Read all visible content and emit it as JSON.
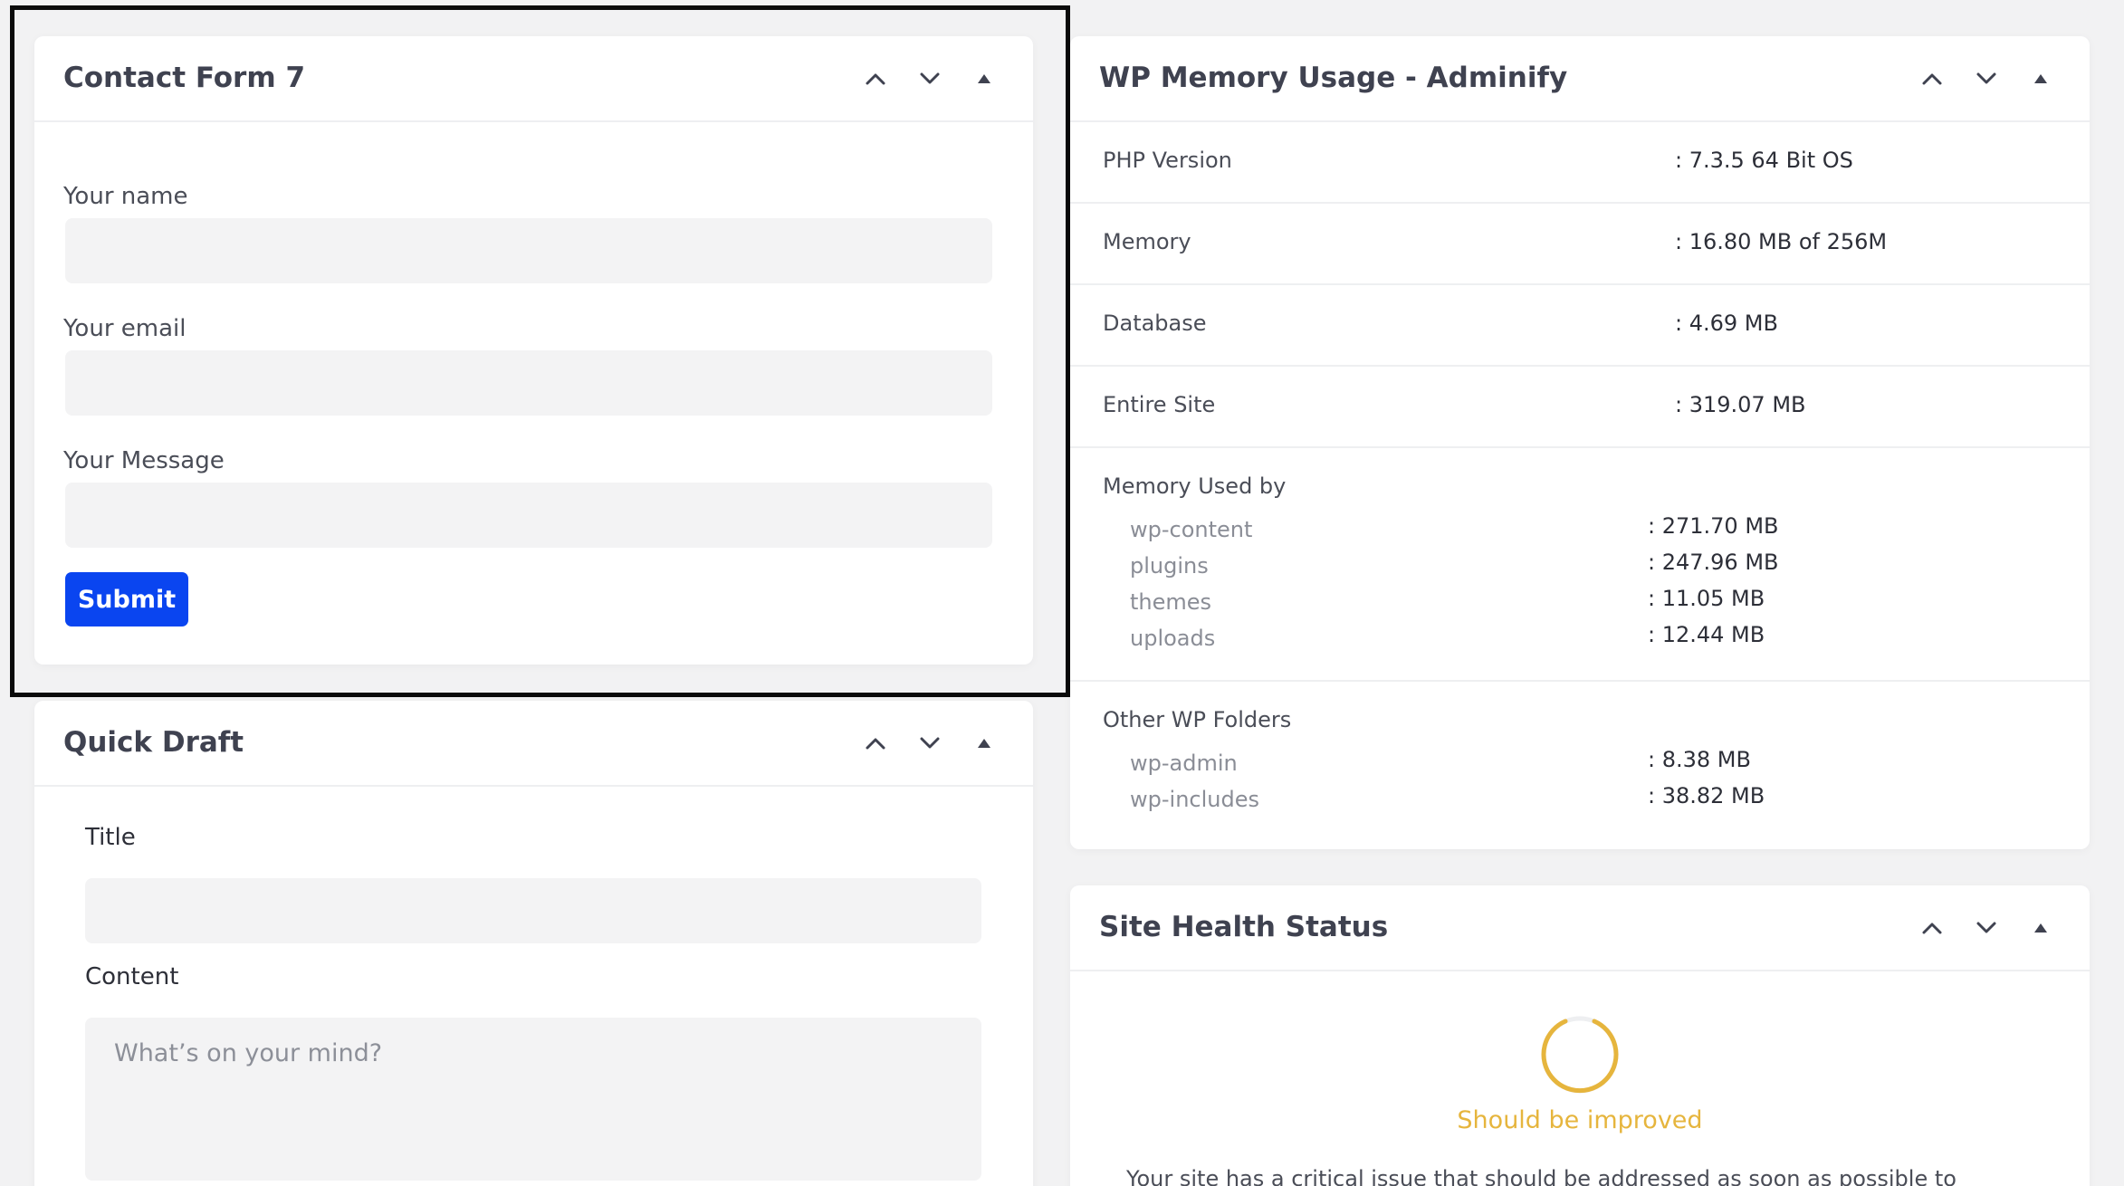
{
  "contact_form": {
    "title": "Contact Form 7",
    "name_label": "Your name",
    "name_value": "",
    "email_label": "Your email",
    "email_value": "",
    "message_label": "Your Message",
    "message_value": "",
    "submit_label": "Submit"
  },
  "quick_draft": {
    "title": "Quick Draft",
    "title_label": "Title",
    "title_value": "",
    "content_label": "Content",
    "content_placeholder": "What’s on your mind?"
  },
  "memory_usage": {
    "title": "WP Memory Usage - Adminify",
    "rows": [
      {
        "label": "PHP Version",
        "value": ": 7.3.5 64 Bit OS"
      },
      {
        "label": "Memory",
        "value": ": 16.80 MB of 256M"
      },
      {
        "label": "Database",
        "value": ": 4.69 MB"
      },
      {
        "label": "Entire Site",
        "value": ": 319.07 MB"
      }
    ],
    "used_by": {
      "label": "Memory Used by",
      "items": [
        {
          "label": "wp-content",
          "value": ": 271.70 MB"
        },
        {
          "label": "plugins",
          "value": ": 247.96 MB"
        },
        {
          "label": "themes",
          "value": ": 11.05 MB"
        },
        {
          "label": "uploads",
          "value": ": 12.44 MB"
        }
      ]
    },
    "other_folders": {
      "label": "Other WP Folders",
      "items": [
        {
          "label": "wp-admin",
          "value": ": 8.38 MB"
        },
        {
          "label": "wp-includes",
          "value": ": 38.82 MB"
        }
      ]
    }
  },
  "site_health": {
    "title": "Site Health Status",
    "status": "Should be improved",
    "description": "Your site has a critical issue that should be addressed as soon as possible to"
  },
  "colors": {
    "accent_blue": "#0a45f0",
    "health_warning": "#e6b53d",
    "card_bg": "#ffffff",
    "page_bg": "#f2f2f3"
  },
  "icons": {
    "move_up": "chevron-up-icon",
    "move_down": "chevron-down-icon",
    "toggle": "caret-up-icon"
  }
}
